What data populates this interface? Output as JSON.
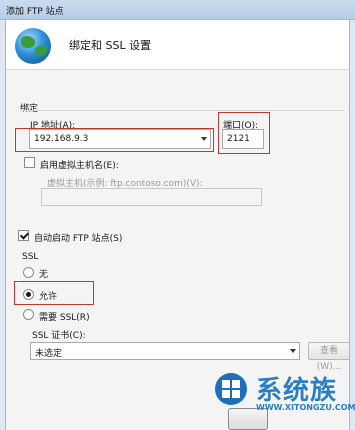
{
  "window_title": "添加 FTP 站点",
  "header_title": "绑定和 SSL 设置",
  "binding": {
    "group_label": "绑定",
    "ip_label": "IP 地址(A):",
    "ip_value": "192.168.9.3",
    "port_label": "端口(O):",
    "port_value": "2121",
    "virtual_host_checkbox_label": "启用虚拟主机名(E):",
    "virtual_host_checked": false,
    "virtual_host_label": "虚拟主机(示例: ftp.contoso.com)(V):",
    "virtual_host_value": ""
  },
  "auto_start": {
    "label": "自动启动 FTP 站点(S)",
    "checked": true
  },
  "ssl": {
    "group_label": "SSL",
    "options": [
      {
        "label": "无",
        "selected": false
      },
      {
        "label": "允许",
        "selected": true
      },
      {
        "label": "需要 SSL(R)",
        "selected": false
      }
    ],
    "cert_label": "SSL 证书(C):",
    "cert_value": "未选定",
    "view_button": "查看(W)..."
  },
  "watermark": {
    "text": "系统族",
    "url": "WWW.XITONGZU.COM"
  },
  "colors": {
    "highlight_box": "#c0392b",
    "watermark": "#2a7ec8"
  }
}
